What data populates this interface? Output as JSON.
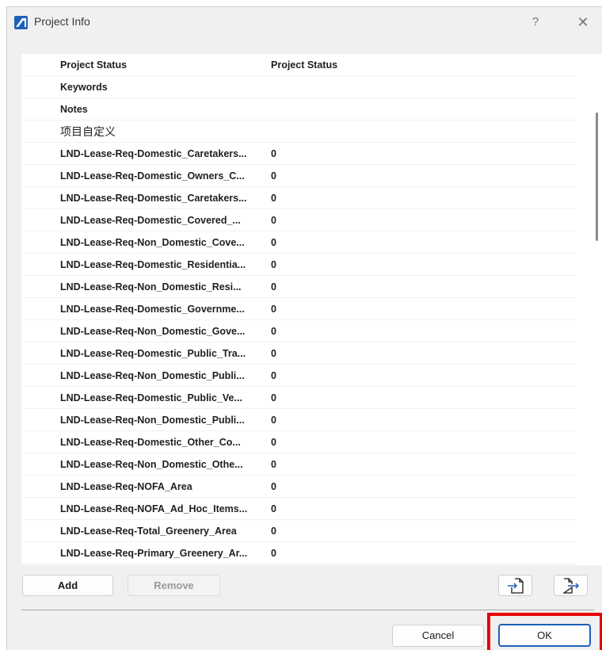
{
  "window": {
    "title": "Project Info",
    "help_label": "?",
    "close_label": "✕",
    "accent_color": "#1e60b8"
  },
  "list": {
    "rows": [
      {
        "key": "Project Status",
        "value": "Project  Status"
      },
      {
        "key": "Keywords",
        "value": ""
      },
      {
        "key": "Notes",
        "value": ""
      },
      {
        "key": "项目自定义",
        "value": ""
      },
      {
        "key": "LND-Lease-Req-Domestic_Caretakers...",
        "value": "0"
      },
      {
        "key": "LND-Lease-Req-Domestic_Owners_C...",
        "value": "0"
      },
      {
        "key": "LND-Lease-Req-Domestic_Caretakers...",
        "value": "0"
      },
      {
        "key": "LND-Lease-Req-Domestic_Covered_...",
        "value": "0"
      },
      {
        "key": "LND-Lease-Req-Non_Domestic_Cove...",
        "value": "0"
      },
      {
        "key": "LND-Lease-Req-Domestic_Residentia...",
        "value": "0"
      },
      {
        "key": "LND-Lease-Req-Non_Domestic_Resi...",
        "value": "0"
      },
      {
        "key": "LND-Lease-Req-Domestic_Governme...",
        "value": "0"
      },
      {
        "key": "LND-Lease-Req-Non_Domestic_Gove...",
        "value": "0"
      },
      {
        "key": "LND-Lease-Req-Domestic_Public_Tra...",
        "value": "0"
      },
      {
        "key": "LND-Lease-Req-Non_Domestic_Publi...",
        "value": "0"
      },
      {
        "key": "LND-Lease-Req-Domestic_Public_Ve...",
        "value": "0"
      },
      {
        "key": "LND-Lease-Req-Non_Domestic_Publi...",
        "value": "0"
      },
      {
        "key": "LND-Lease-Req-Domestic_Other_Co...",
        "value": "0"
      },
      {
        "key": "LND-Lease-Req-Non_Domestic_Othe...",
        "value": "0"
      },
      {
        "key": "LND-Lease-Req-NOFA_Area",
        "value": "0"
      },
      {
        "key": "LND-Lease-Req-NOFA_Ad_Hoc_Items...",
        "value": "0"
      },
      {
        "key": "LND-Lease-Req-Total_Greenery_Area",
        "value": "0"
      },
      {
        "key": "LND-Lease-Req-Primary_Greenery_Ar...",
        "value": "0"
      }
    ]
  },
  "buttons": {
    "add": "Add",
    "remove": "Remove",
    "import_icon": "import-icon",
    "export_icon": "export-icon",
    "cancel": "Cancel",
    "ok": "OK"
  },
  "highlight_color": "#e8000b"
}
